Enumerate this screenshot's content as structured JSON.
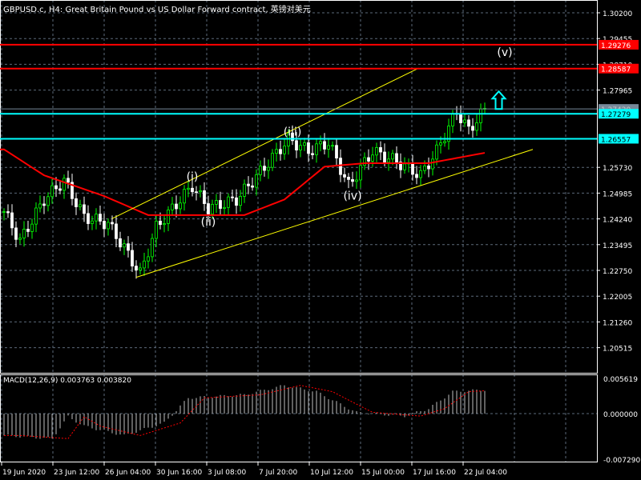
{
  "title": "GBPUSD.c, H4:  Great Britain Pound vs US Dollar Forward contract, 英镑对美元",
  "macd_label": "MACD(12,26,9) 0.003763 0.003820",
  "colors": {
    "bull": "#00ff00",
    "bear": "#ffffff",
    "ma": "#ff0000",
    "level_red": "#ff0000",
    "level_cyan": "#00ffff",
    "channel": "#ffff00",
    "grid": "#5c6a7a",
    "signal": "#ff0000"
  },
  "price_axis": {
    "max": 1.302,
    "step": 0.00745,
    "ticks": [
      "1.30200",
      "1.29455",
      "1.28710",
      "1.27965",
      "1.25730",
      "1.24985",
      "1.24240",
      "1.23495",
      "1.22750",
      "1.22005",
      "1.21260",
      "1.20515"
    ]
  },
  "levels": [
    {
      "price": 1.29276,
      "label": "1.29276",
      "color": "#ff0000",
      "text": "#ffffff"
    },
    {
      "price": 1.28587,
      "label": "1.28587",
      "color": "#ff0000",
      "text": "#ffffff"
    },
    {
      "price": 1.2742,
      "label": "1.27420",
      "color": "#778899",
      "text": "#cccccc"
    },
    {
      "price": 1.27279,
      "label": "1.27279",
      "color": "#00ffff",
      "text": "#000000"
    },
    {
      "price": 1.26557,
      "label": "1.26557",
      "color": "#00ffff",
      "text": "#000000"
    }
  ],
  "macd_axis": {
    "max": 0.005619,
    "min": -0.00729,
    "ticks": [
      "0.005619",
      "0.000000",
      "-0.007290"
    ]
  },
  "time_axis": [
    "19 Jun 2020",
    "23 Jun 12:00",
    "26 Jun 04:00",
    "30 Jun 16:00",
    "3 Jul 08:00",
    "7 Jul 20:00",
    "10 Jul 12:00",
    "15 Jul 00:00",
    "17 Jul 16:00",
    "22 Jul 04:00"
  ],
  "price_path": [
    [
      0,
      1.2445
    ],
    [
      4,
      1.236
    ],
    [
      10,
      1.248
    ],
    [
      15,
      1.2535
    ],
    [
      20,
      1.243
    ],
    [
      26,
      1.241
    ],
    [
      30,
      1.234
    ],
    [
      34,
      1.2265
    ],
    [
      38,
      1.24
    ],
    [
      47,
      1.252
    ],
    [
      51,
      1.2455
    ],
    [
      58,
      1.248
    ],
    [
      64,
      1.256
    ],
    [
      71,
      1.2655
    ],
    [
      76,
      1.262
    ],
    [
      81,
      1.2645
    ],
    [
      86,
      1.252
    ],
    [
      92,
      1.262
    ],
    [
      98,
      1.259
    ],
    [
      104,
      1.255
    ],
    [
      108,
      1.262
    ],
    [
      113,
      1.2735
    ],
    [
      116,
      1.268
    ],
    [
      120,
      1.274
    ]
  ],
  "ma_path": [
    [
      0,
      1.2625
    ],
    [
      10,
      1.255
    ],
    [
      25,
      1.249
    ],
    [
      36,
      1.2435
    ],
    [
      50,
      1.2435
    ],
    [
      60,
      1.2435
    ],
    [
      70,
      1.248
    ],
    [
      80,
      1.2575
    ],
    [
      90,
      1.2585
    ],
    [
      106,
      1.2585
    ],
    [
      120,
      1.2615
    ]
  ],
  "macd_hist": [
    [
      0,
      -0.0035
    ],
    [
      12,
      -0.004
    ],
    [
      16,
      -0.0005
    ],
    [
      20,
      -0.002
    ],
    [
      30,
      -0.0035
    ],
    [
      40,
      -0.0015
    ],
    [
      46,
      0.0025
    ],
    [
      60,
      0.003
    ],
    [
      70,
      0.0045
    ],
    [
      78,
      0.0035
    ],
    [
      84,
      0.0015
    ],
    [
      88,
      0.0002
    ],
    [
      100,
      -0.0004
    ],
    [
      106,
      0.0008
    ],
    [
      112,
      0.0035
    ],
    [
      120,
      0.0038
    ]
  ],
  "wave_labels": [
    {
      "text": "(i)",
      "bar": 47,
      "price": 1.2535
    },
    {
      "text": "(ii)",
      "bar": 51,
      "price": 1.2405
    },
    {
      "text": "(iii)",
      "bar": 72,
      "price": 1.2665
    },
    {
      "text": "(iv)",
      "bar": 87,
      "price": 1.248
    },
    {
      "text": "(v)",
      "bar": 125,
      "price": 1.2895
    }
  ],
  "channel": [
    [
      [
        27,
        1.2425
      ],
      [
        103.5,
        1.286
      ]
    ],
    [
      [
        33,
        1.2255
      ],
      [
        132,
        1.2625
      ]
    ]
  ],
  "arrow": {
    "bar": 123.5,
    "price": 1.2765,
    "color": "#00ffff"
  }
}
